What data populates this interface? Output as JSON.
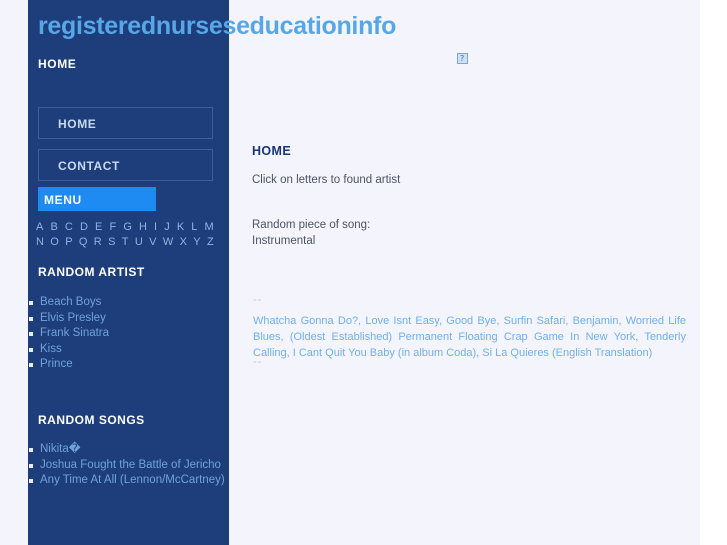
{
  "site": {
    "title": "registerednurseseducationinfo",
    "kicker": "HOME"
  },
  "colors": {
    "sidebar_bg": "#1e3d7b",
    "page_bg": "#f4f4fd",
    "accent": "#1d8bf2",
    "title_color": "#57a7e8",
    "link_color": "#6fb0ee"
  },
  "sidebar": {
    "nav": [
      {
        "label": "HOME"
      },
      {
        "label": "CONTACT"
      }
    ],
    "menu_label": "MENU",
    "alphabet_row1": [
      "A",
      "B",
      "C",
      "D",
      "E",
      "F",
      "G",
      "H",
      "I",
      "J",
      "K",
      "L",
      "M"
    ],
    "alphabet_row2": [
      "N",
      "O",
      "P",
      "Q",
      "R",
      "S",
      "T",
      "U",
      "V",
      "W",
      "X",
      "Y",
      "Z"
    ],
    "random_artist_heading": "RANDOM ARTIST",
    "random_artists": [
      "Beach Boys",
      "Elvis Presley",
      "Frank Sinatra",
      "Kiss",
      "Prince"
    ],
    "random_songs_heading": "RANDOM SONGS",
    "random_songs": [
      "Nikita�",
      "Joshua Fought the Battle of Jericho",
      "Any Time At All (Lennon/McCartney)"
    ]
  },
  "content": {
    "title": "HOME",
    "click_text": "Click on letters to found artist",
    "random_piece_label": "Random piece of song:",
    "random_piece_value": "Instrumental",
    "separator_top": "--",
    "separator_bottom": "--",
    "song_links": "Whatcha Gonna Do?, Love Isnt Easy, Good Bye, Surfin Safari, Benjamin, Worried Life Blues, (Oldest Established) Permanent Floating Crap Game In New York, Tenderly Calling, I Cant Quit You Baby (in album Coda), Si La Quieres (English Translation)",
    "broken_image_alt": "?"
  }
}
